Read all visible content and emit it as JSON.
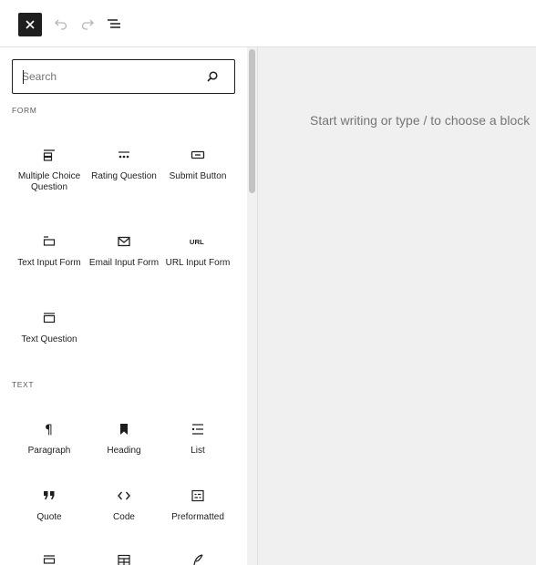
{
  "toolbar": {
    "close_icon": "close-icon",
    "undo_icon": "undo-icon",
    "redo_icon": "redo-icon",
    "document_overview_icon": "list-view-icon"
  },
  "search": {
    "placeholder": "Search",
    "icon": "search-icon"
  },
  "categories": [
    {
      "label": "FORM",
      "blocks": [
        {
          "label": "Multiple Choice Question",
          "icon": "multiple-choice-icon"
        },
        {
          "label": "Rating Question",
          "icon": "rating-icon"
        },
        {
          "label": "Submit Button",
          "icon": "button-icon"
        },
        {
          "label": "Text Input Form",
          "icon": "text-input-icon"
        },
        {
          "label": "Email Input Form",
          "icon": "envelope-icon"
        },
        {
          "label": "URL Input Form",
          "icon": "url-icon"
        },
        {
          "label": "Text Question",
          "icon": "text-question-icon"
        }
      ]
    },
    {
      "label": "TEXT",
      "blocks": [
        {
          "label": "Paragraph",
          "icon": "paragraph-icon"
        },
        {
          "label": "Heading",
          "icon": "heading-icon"
        },
        {
          "label": "List",
          "icon": "list-icon"
        },
        {
          "label": "Quote",
          "icon": "quote-icon"
        },
        {
          "label": "Code",
          "icon": "code-icon"
        },
        {
          "label": "Preformatted",
          "icon": "preformatted-icon"
        },
        {
          "label": "",
          "icon": "pullquote-icon"
        },
        {
          "label": "",
          "icon": "table-icon"
        },
        {
          "label": "",
          "icon": "verse-icon"
        }
      ]
    }
  ],
  "editor": {
    "placeholder": "Start writing or type / to choose a block"
  },
  "colors": {
    "dark": "#1e1e1e",
    "canvas": "#f0f0f0",
    "muted": "#757575",
    "border": "#e0e0e0"
  }
}
